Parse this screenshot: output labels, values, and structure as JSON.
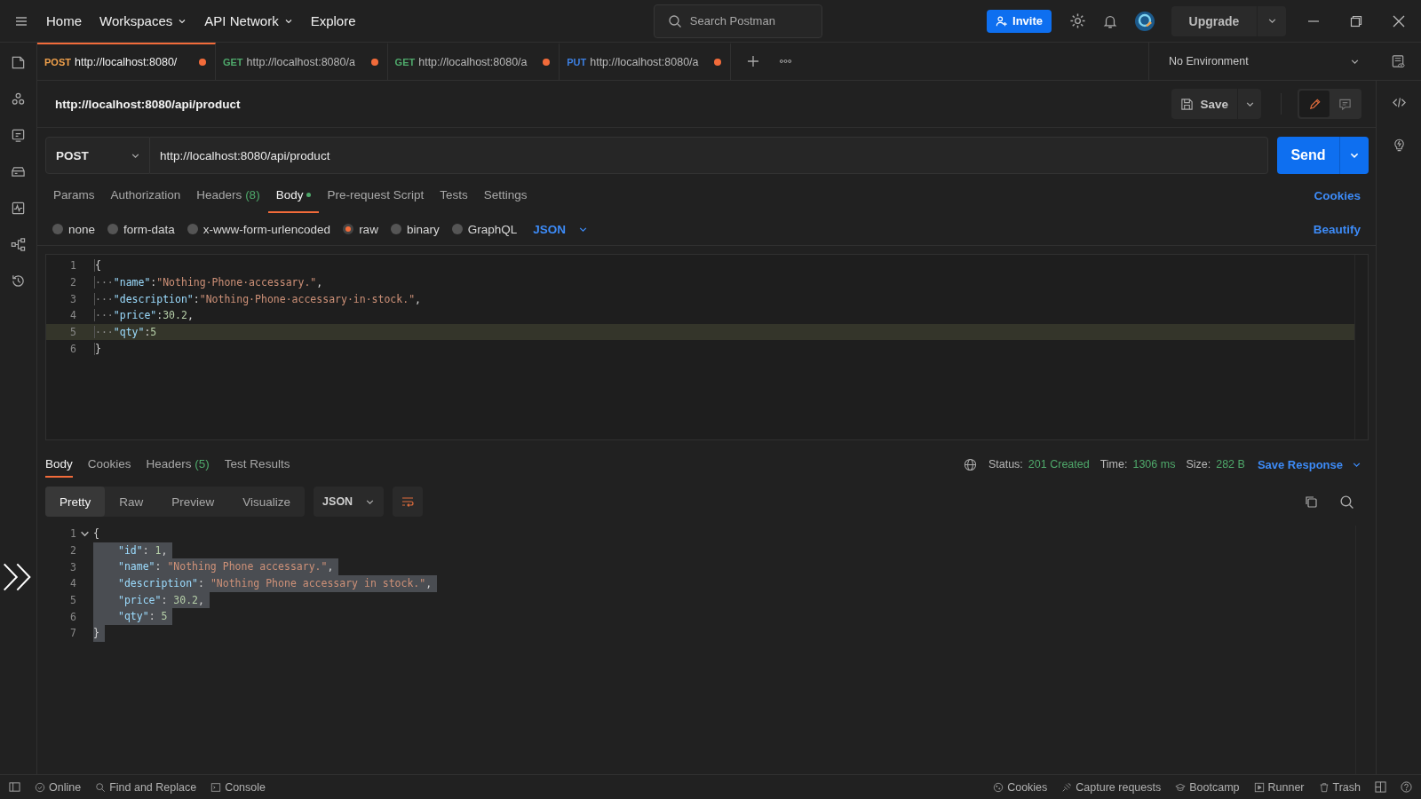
{
  "nav": [
    {
      "label": "Home",
      "dropdown": false
    },
    {
      "label": "Workspaces",
      "dropdown": true
    },
    {
      "label": "API Network",
      "dropdown": true
    },
    {
      "label": "Explore",
      "dropdown": false
    }
  ],
  "search": {
    "placeholder": "Search Postman"
  },
  "invite": "Invite",
  "upgrade": "Upgrade",
  "tabs": [
    {
      "method": "POST",
      "color": "#f0a04b",
      "url": "http://localhost:8080/",
      "selected": true,
      "unsaved": true
    },
    {
      "method": "GET",
      "color": "#4fa96b",
      "url": "http://localhost:8080/a",
      "selected": false,
      "unsaved": true
    },
    {
      "method": "GET",
      "color": "#4fa96b",
      "url": "http://localhost:8080/a",
      "selected": false,
      "unsaved": true
    },
    {
      "method": "PUT",
      "color": "#3d7fe0",
      "url": "http://localhost:8080/a",
      "selected": false,
      "unsaved": true
    }
  ],
  "environment": "No Environment",
  "request": {
    "title": "http://localhost:8080/api/product",
    "save": "Save",
    "method": "POST",
    "url": "http://localhost:8080/api/product",
    "send": "Send",
    "tabs": [
      {
        "label": "Params",
        "selected": false
      },
      {
        "label": "Authorization",
        "selected": false
      },
      {
        "label": "Headers",
        "count": "(8)",
        "selected": false
      },
      {
        "label": "Body",
        "selected": true,
        "has_content": true
      },
      {
        "label": "Pre-request Script",
        "selected": false
      },
      {
        "label": "Tests",
        "selected": false
      },
      {
        "label": "Settings",
        "selected": false
      }
    ],
    "cookies": "Cookies",
    "body_types": [
      {
        "label": "none",
        "selected": false
      },
      {
        "label": "form-data",
        "selected": false
      },
      {
        "label": "x-www-form-urlencoded",
        "selected": false
      },
      {
        "label": "raw",
        "selected": true
      },
      {
        "label": "binary",
        "selected": false
      },
      {
        "label": "GraphQL",
        "selected": false
      }
    ],
    "format": "JSON",
    "beautify": "Beautify",
    "lines": [
      {
        "number": "1",
        "active": false,
        "tokens": [
          {
            "kind": "punct",
            "text": "{"
          }
        ]
      },
      {
        "number": "2",
        "active": false,
        "tokens": [
          {
            "kind": "ws",
            "text": "···"
          },
          {
            "kind": "key",
            "text": "\"name\""
          },
          {
            "kind": "punct",
            "text": ":"
          },
          {
            "kind": "string",
            "text": "\"Nothing·Phone·accessary.\""
          },
          {
            "kind": "punct",
            "text": ","
          }
        ]
      },
      {
        "number": "3",
        "active": false,
        "tokens": [
          {
            "kind": "ws",
            "text": "···"
          },
          {
            "kind": "key",
            "text": "\"description\""
          },
          {
            "kind": "punct",
            "text": ":"
          },
          {
            "kind": "string",
            "text": "\"Nothing·Phone·accessary·in·stock.\""
          },
          {
            "kind": "punct",
            "text": ","
          }
        ]
      },
      {
        "number": "4",
        "active": false,
        "tokens": [
          {
            "kind": "ws",
            "text": "···"
          },
          {
            "kind": "key",
            "text": "\"price\""
          },
          {
            "kind": "punct",
            "text": ":"
          },
          {
            "kind": "number",
            "text": "30.2"
          },
          {
            "kind": "punct",
            "text": ","
          }
        ]
      },
      {
        "number": "5",
        "active": true,
        "tokens": [
          {
            "kind": "ws",
            "text": "···"
          },
          {
            "kind": "key",
            "text": "\"qty\""
          },
          {
            "kind": "punct",
            "text": ":"
          },
          {
            "kind": "number",
            "text": "5"
          }
        ]
      },
      {
        "number": "6",
        "active": false,
        "tokens": [
          {
            "kind": "punct",
            "text": "}"
          }
        ]
      }
    ]
  },
  "response": {
    "tabs": [
      {
        "label": "Body",
        "selected": true
      },
      {
        "label": "Cookies",
        "selected": false
      },
      {
        "label": "Headers",
        "count": "(5)",
        "selected": false
      },
      {
        "label": "Test Results",
        "selected": false
      }
    ],
    "status_label": "Status:",
    "status": "201 Created",
    "time_label": "Time:",
    "time": "1306 ms",
    "size_label": "Size:",
    "size": "282 B",
    "save_response": "Save Response",
    "views": [
      {
        "label": "Pretty",
        "selected": true
      },
      {
        "label": "Raw",
        "selected": false
      },
      {
        "label": "Preview",
        "selected": false
      },
      {
        "label": "Visualize",
        "selected": false
      }
    ],
    "format": "JSON",
    "lines": [
      {
        "number": "1",
        "selected": false,
        "fold": true,
        "tokens": [
          {
            "kind": "punct",
            "text": "{"
          }
        ]
      },
      {
        "number": "2",
        "selected": true,
        "indented": true,
        "tokens": [
          {
            "kind": "key",
            "text": "\"id\""
          },
          {
            "kind": "punct",
            "text": ": "
          },
          {
            "kind": "number",
            "text": "1"
          },
          {
            "kind": "punct",
            "text": ","
          }
        ]
      },
      {
        "number": "3",
        "selected": true,
        "indented": true,
        "tokens": [
          {
            "kind": "key",
            "text": "\"name\""
          },
          {
            "kind": "punct",
            "text": ": "
          },
          {
            "kind": "string",
            "text": "\"Nothing Phone accessary.\""
          },
          {
            "kind": "punct",
            "text": ","
          }
        ]
      },
      {
        "number": "4",
        "selected": true,
        "indented": true,
        "tokens": [
          {
            "kind": "key",
            "text": "\"description\""
          },
          {
            "kind": "punct",
            "text": ": "
          },
          {
            "kind": "string",
            "text": "\"Nothing Phone accessary in stock.\""
          },
          {
            "kind": "punct",
            "text": ","
          }
        ]
      },
      {
        "number": "5",
        "selected": true,
        "indented": true,
        "tokens": [
          {
            "kind": "key",
            "text": "\"price\""
          },
          {
            "kind": "punct",
            "text": ": "
          },
          {
            "kind": "number",
            "text": "30.2"
          },
          {
            "kind": "punct",
            "text": ","
          }
        ]
      },
      {
        "number": "6",
        "selected": true,
        "indented": true,
        "tokens": [
          {
            "kind": "key",
            "text": "\"qty\""
          },
          {
            "kind": "punct",
            "text": ": "
          },
          {
            "kind": "number",
            "text": "5"
          }
        ]
      },
      {
        "number": "7",
        "selected": true,
        "tokens": [
          {
            "kind": "punct",
            "text": "}"
          }
        ]
      }
    ]
  },
  "status_bar": {
    "left": [
      "Online",
      "Find and Replace",
      "Console"
    ],
    "right": [
      "Cookies",
      "Capture requests",
      "Bootcamp",
      "Runner",
      "Trash"
    ]
  }
}
